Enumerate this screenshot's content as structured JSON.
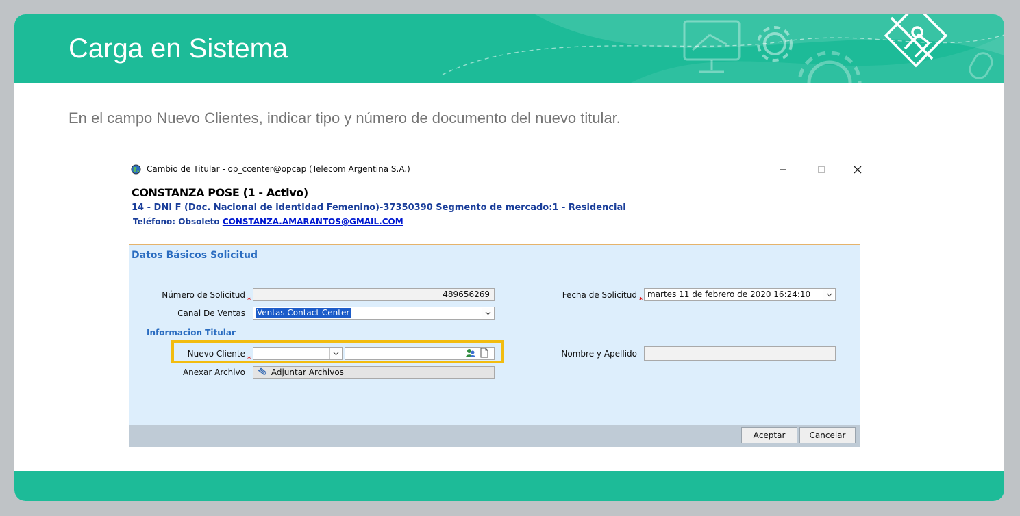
{
  "slide": {
    "title": "Carga en Sistema",
    "instruction": "En el campo Nuevo Clientes, indicar tipo y número de documento del nuevo titular."
  },
  "window": {
    "title": "Cambio de Titular - op_ccenter@opcap (Telecom Argentina S.A.)",
    "customer_name": "CONSTANZA POSE (1 - Activo)",
    "doc_line": "14 - DNI F (Doc. Nacional de identidad Femenino)-37350390 Segmento de mercado:1 - Residencial",
    "phone_label": "Teléfono: Obsoleto",
    "email": "CONSTANZA.AMARANTOS@GMAIL.COM"
  },
  "form": {
    "section_title": "Datos Básicos Solicitud",
    "numero_label": "Número de Solicitud",
    "numero_value": "489656269",
    "fecha_label": "Fecha de Solicitud",
    "fecha_value": "martes 11 de febrero de 2020 16:24:10",
    "canal_label": "Canal De Ventas",
    "canal_value": "Ventas Contact Center",
    "info_title": "Informacion Titular",
    "nuevo_label": "Nuevo Cliente",
    "nuevo_tipo": "",
    "nuevo_numero": "",
    "nombre_label": "Nombre y Apellido",
    "nombre_value": "",
    "anexar_label": "Anexar Archivo",
    "adjuntar_label": "Adjuntar Archivos"
  },
  "buttons": {
    "aceptar_rest": "ceptar",
    "aceptar_key": "A",
    "cancelar_rest": "ancelar",
    "cancelar_key": "C"
  },
  "colors": {
    "banner": "#1dbb98",
    "highlight": "#f2bc10",
    "panel": "#ddeefc",
    "section_title": "#2a6cc0",
    "customer_info": "#1a3e9a"
  },
  "icons": [
    "globe-icon",
    "minimize-icon",
    "maximize-icon",
    "close-icon",
    "chevron-down-icon",
    "search-people-icon",
    "document-icon",
    "paperclip-icon",
    "pencil-hands-icon",
    "gear-icon",
    "monitor-icon",
    "mouse-icon"
  ]
}
